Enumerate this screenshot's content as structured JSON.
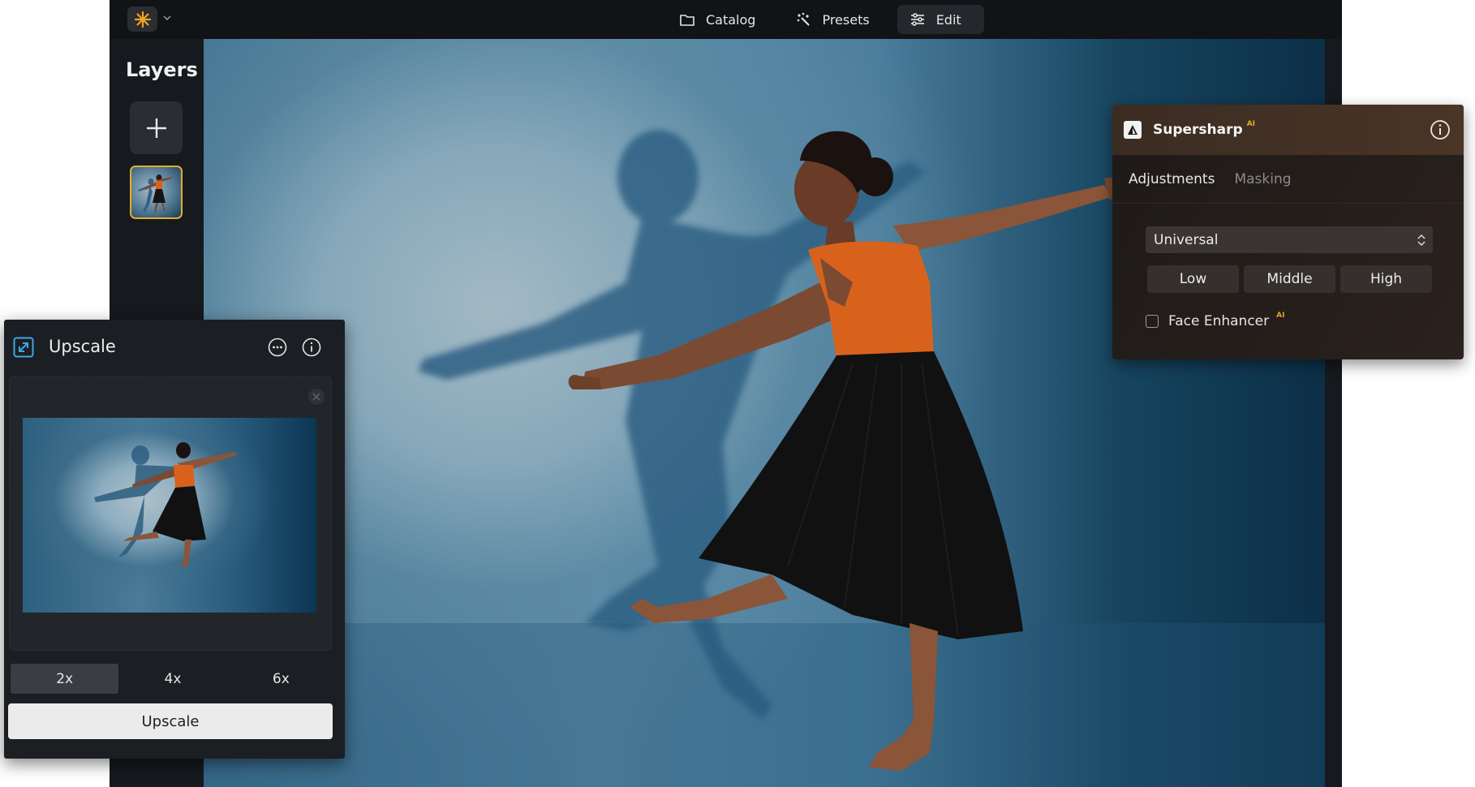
{
  "app": {
    "nav": [
      {
        "label": "Catalog",
        "icon": "folder-icon"
      },
      {
        "label": "Presets",
        "icon": "sparkle-icon"
      },
      {
        "label": "Edit",
        "icon": "sliders-icon"
      }
    ],
    "active_nav": "Edit",
    "accent_color": "#e7ac2a"
  },
  "layers": {
    "title": "Layers"
  },
  "supersharp": {
    "title": "Supersharp",
    "ai_badge": "AI",
    "tabs": [
      "Adjustments",
      "Masking"
    ],
    "active_tab": "Adjustments",
    "mode_select": "Universal",
    "strength_options": [
      "Low",
      "Middle",
      "High"
    ],
    "face_enhancer_label": "Face Enhancer",
    "face_enhancer_ai_badge": "AI",
    "face_enhancer_checked": false
  },
  "upscale": {
    "title": "Upscale",
    "scale_options": [
      "2x",
      "4x",
      "6x"
    ],
    "selected_scale": "2x",
    "button_label": "Upscale"
  }
}
